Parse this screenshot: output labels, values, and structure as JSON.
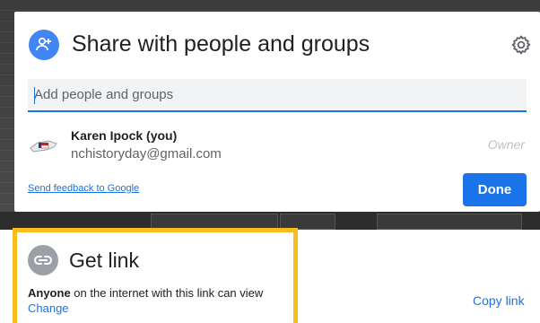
{
  "share_dialog": {
    "title": "Share with people and groups",
    "input": {
      "placeholder": "Add people and groups",
      "value": ""
    },
    "people": [
      {
        "name": "Karen Ipock (you)",
        "email": "nchistoryday@gmail.com",
        "role": "Owner"
      }
    ],
    "feedback_link": "Send feedback to Google",
    "done_label": "Done",
    "icons": {
      "header": "person-add-icon",
      "settings": "gear-icon"
    },
    "colors": {
      "accent": "#1a73e8",
      "header_icon": "#4285f4"
    }
  },
  "get_link": {
    "title": "Get link",
    "access_bold": "Anyone",
    "access_rest": " on the internet with this link can view",
    "change_label": "Change",
    "copy_label": "Copy link",
    "icons": {
      "header": "link-icon"
    },
    "colors": {
      "highlight": "#f7bd1e"
    }
  }
}
